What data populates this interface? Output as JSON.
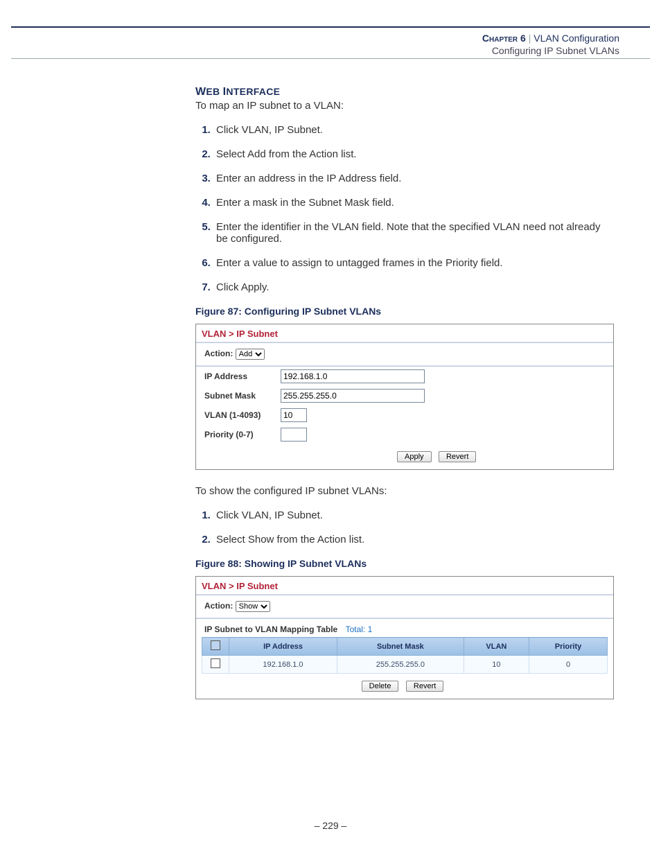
{
  "header": {
    "chapter_label": "Chapter 6",
    "pipe": "|",
    "title": "VLAN Configuration",
    "subtitle": "Configuring IP Subnet VLANs"
  },
  "section_heading": {
    "w": "W",
    "eb": "EB",
    "sp": " ",
    "i": "I",
    "nterface": "NTERFACE"
  },
  "intro1": "To map an IP subnet to a VLAN:",
  "steps1": [
    "Click VLAN, IP Subnet.",
    "Select Add from the Action list.",
    "Enter an address in the IP Address field.",
    "Enter a mask in the Subnet Mask field.",
    "Enter the identifier in the VLAN field. Note that the specified VLAN need not already be configured.",
    "Enter a value to assign to untagged frames in the Priority field.",
    "Click Apply."
  ],
  "fig87_caption": "Figure 87:  Configuring IP Subnet VLANs",
  "panel1": {
    "breadcrumb": "VLAN > IP Subnet",
    "action_label": "Action:",
    "action_value": "Add",
    "fields": {
      "ip_label": "IP Address",
      "ip_value": "192.168.1.0",
      "mask_label": "Subnet Mask",
      "mask_value": "255.255.255.0",
      "vlan_label": "VLAN (1-4093)",
      "vlan_value": "10",
      "prio_label": "Priority (0-7)",
      "prio_value": ""
    },
    "apply": "Apply",
    "revert": "Revert"
  },
  "intro2": "To show the configured IP subnet VLANs:",
  "steps2": [
    "Click VLAN, IP Subnet.",
    "Select Show from the Action list."
  ],
  "fig88_caption": "Figure 88:  Showing IP Subnet VLANs",
  "panel2": {
    "breadcrumb": "VLAN > IP Subnet",
    "action_label": "Action:",
    "action_value": "Show",
    "table_title": "IP Subnet to VLAN Mapping Table",
    "total_label": "Total: 1",
    "headers": {
      "ip": "IP Address",
      "mask": "Subnet Mask",
      "vlan": "VLAN",
      "prio": "Priority"
    },
    "rows": [
      {
        "ip": "192.168.1.0",
        "mask": "255.255.255.0",
        "vlan": "10",
        "prio": "0"
      }
    ],
    "delete": "Delete",
    "revert": "Revert"
  },
  "footer": {
    "dash1": "–  ",
    "page": "229",
    "dash2": "  –"
  }
}
